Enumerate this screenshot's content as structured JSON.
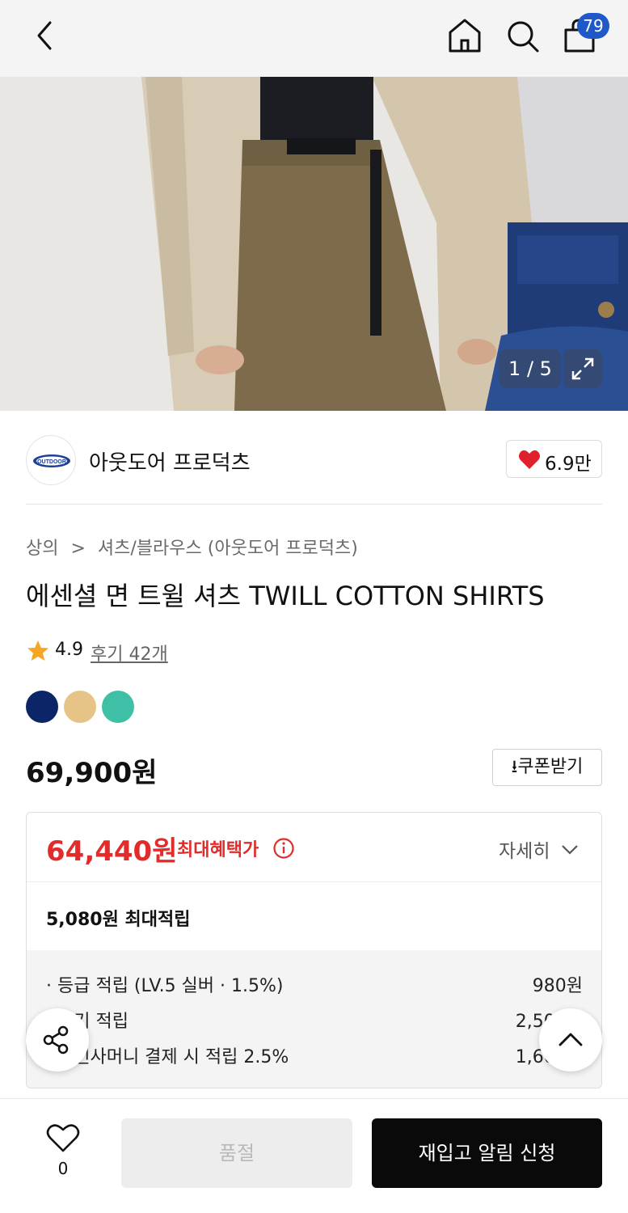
{
  "header": {
    "icons": [
      "back-arrow-icon",
      "home-icon",
      "search-icon",
      "shopping-bag-icon"
    ],
    "cart_count": "79"
  },
  "gallery": {
    "counter": "1 / 5",
    "expand_icon": "expand-icon"
  },
  "brand": {
    "name": "아웃도어 프로덕츠",
    "logo_text": "OUTDOOR",
    "like_count": "6.9만",
    "heart_color": "#e0202a"
  },
  "breadcrumb": {
    "category": "상의",
    "separator": ">",
    "subcategory": "셔츠/블라우스 (아웃도어 프로덕츠)"
  },
  "product": {
    "title": "에센셜 면 트윌 셔츠 TWILL COTTON SHIRTS",
    "rating": "4.9",
    "review_link": "후기 42개",
    "swatches": [
      "#0b2566",
      "#e6c487",
      "#3fbfa5"
    ],
    "price": "69,900원",
    "coupon_button": "쿠폰받기"
  },
  "benefits": {
    "max_price": "64,440원",
    "max_label": "최대혜택가",
    "detail_label": "자세히",
    "points_total": "5,080원 최대적립",
    "rows": [
      {
        "label": "· 등급 적립 (LV.5 실버 · 1.5%)",
        "value": "980원"
      },
      {
        "label": "· 후기 적립",
        "value": "2,500원"
      },
      {
        "label": "· 무신사머니 결제 시 적립 2.5%",
        "value": "1,600원"
      }
    ],
    "accent_color": "#e22b2b"
  },
  "floating": {
    "share_icon": "share-icon",
    "top_icon": "chevron-up-icon"
  },
  "bottom_bar": {
    "wish_count": "0",
    "soldout_label": "품절",
    "restock_label": "재입고 알림 신청"
  }
}
